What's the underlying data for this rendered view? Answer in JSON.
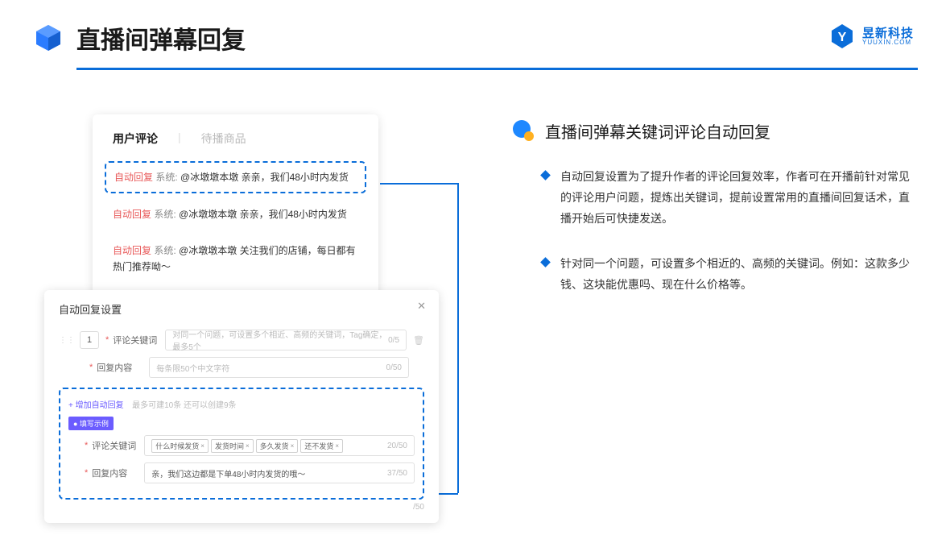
{
  "pageTitle": "直播间弹幕回复",
  "brand": {
    "cn": "昱新科技",
    "en": "YUUXIN.COM"
  },
  "card1": {
    "tabActive": "用户评论",
    "tabInactive": "待播商品",
    "msg1": {
      "auto": "自动回复",
      "sys": " 系统: ",
      "at": "@冰墩墩本墩 ",
      "body": "亲亲，我们48小时内发货"
    },
    "msg2": {
      "auto": "自动回复",
      "sys": " 系统: ",
      "at": "@冰墩墩本墩 ",
      "body": "亲亲，我们48小时内发货"
    },
    "msg3": {
      "auto": "自动回复",
      "sys": " 系统: ",
      "at": "@冰墩墩本墩 ",
      "body": "关注我们的店铺，每日都有热门推荐呦～"
    }
  },
  "card2": {
    "title": "自动回复设置",
    "num": "1",
    "labelKeyword": "评论关键词",
    "placeholderKeyword": "对同一个问题，可设置多个相近、高频的关键词，Tag确定，最多5个",
    "counterKeyword": "0/5",
    "labelContent": "回复内容",
    "placeholderContent": "每条限50个中文字符",
    "counterContent": "0/50",
    "addLink": "+ 增加自动回复",
    "addNote": "最多可建10条 还可以创建9条",
    "exampleBadge": "● 填写示例",
    "exLabelKeyword": "评论关键词",
    "exTags": [
      "什么时候发货",
      "发货时间",
      "多久发货",
      "还不发货"
    ],
    "exCounterK": "20/50",
    "exLabelContent": "回复内容",
    "exContent": "亲，我们这边都是下单48小时内发货的哦～",
    "exCounterC": "37/50",
    "rowNote": "/50"
  },
  "right": {
    "sectionTitle": "直播间弹幕关键词评论自动回复",
    "b1": "自动回复设置为了提升作者的评论回复效率，作者可在开播前针对常见的评论用户问题，提炼出关键词，提前设置常用的直播间回复话术，直播开始后可快捷发送。",
    "b2": "针对同一个问题，可设置多个相近的、高频的关键词。例如：这款多少钱、这块能优惠吗、现在什么价格等。"
  }
}
